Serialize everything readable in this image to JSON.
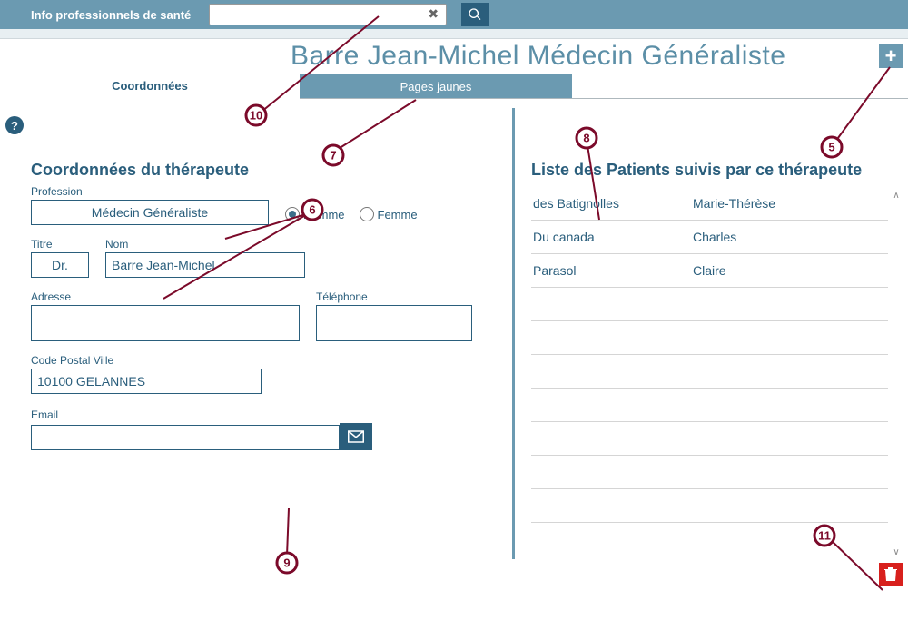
{
  "topbar": {
    "brand": "Info professionnels de santé",
    "search_value": ""
  },
  "title": "Barre Jean-Michel Médecin Généraliste",
  "tabs": {
    "active": "Coordonnées",
    "inactive": "Pages jaunes"
  },
  "form": {
    "section_title": "Coordonnées du thérapeute",
    "profession_label": "Profession",
    "profession_value": "Médecin Généraliste",
    "gender_m": "Homme",
    "gender_f": "Femme",
    "titre_label": "Titre",
    "titre_value": "Dr.",
    "nom_label": "Nom",
    "nom_value": "Barre Jean-Michel",
    "adresse_label": "Adresse",
    "adresse_value": "",
    "tel_label": "Téléphone",
    "tel_value": "",
    "cp_label": "Code Postal Ville",
    "cp_value": "10100 GELANNES",
    "email_label": "Email",
    "email_value": ""
  },
  "patients": {
    "section_title": "Liste des Patients suivis par ce thérapeute",
    "rows": [
      {
        "last": "des Batignolles",
        "first": "Marie-Thérèse"
      },
      {
        "last": "Du canada",
        "first": "Charles"
      },
      {
        "last": "Parasol",
        "first": "Claire"
      }
    ]
  },
  "callouts": {
    "c5": "5",
    "c6": "6",
    "c7": "7",
    "c8": "8",
    "c9": "9",
    "c10": "10",
    "c11": "11"
  }
}
